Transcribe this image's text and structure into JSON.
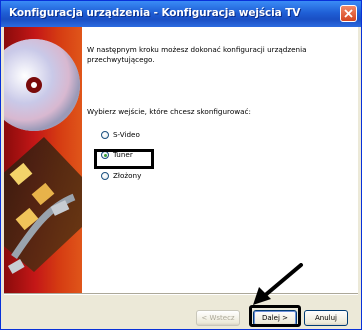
{
  "window": {
    "title": "Konfiguracja urządzenia - Konfiguracja wejścia TV"
  },
  "content": {
    "intro_text": "W następnym kroku możesz dokonać konfiguracji urządzenia przechwytującego.",
    "question_text": "Wybierz wejście, które chcesz skonfigurować:"
  },
  "options": [
    {
      "label": "S-Video",
      "selected": false
    },
    {
      "label": "Tuner",
      "selected": true
    },
    {
      "label": "Złożony",
      "selected": false
    }
  ],
  "buttons": {
    "back_label": "< Wstecz",
    "next_label": "Dalej >",
    "cancel_label": "Anuluj"
  },
  "icons": {
    "close": "close-icon",
    "arrow": "pointer-arrow-icon"
  },
  "colors": {
    "titlebar": "#1f5fd6",
    "selected_radio_dot": "#3ca13c",
    "banner_red": "#c41717"
  }
}
